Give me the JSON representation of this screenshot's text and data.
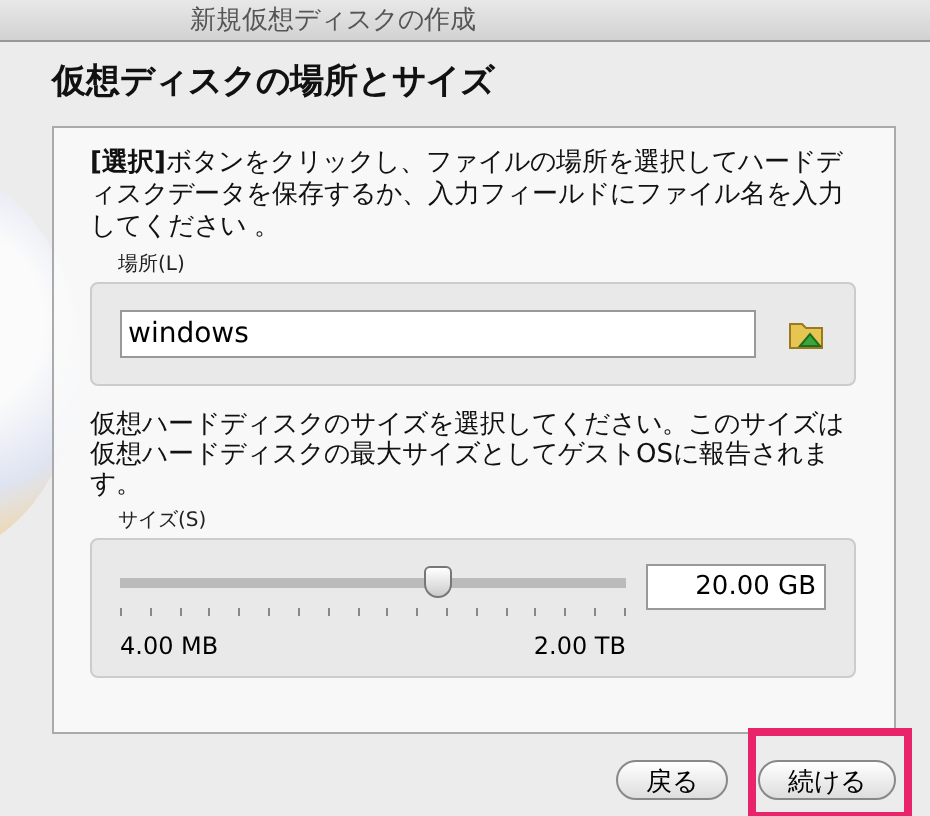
{
  "window": {
    "title": "新規仮想ディスクの作成"
  },
  "heading": "仮想ディスクの場所とサイズ",
  "location_description": "**[選択]**ボタンをクリックし、ファイルの場所を選択してハードディスクデータを保存するか、入力フィールドにファイル名を入力してください 。",
  "location": {
    "label": "場所(L)",
    "value": "windows"
  },
  "size_description": "仮想ハードディスクのサイズを選択してください。このサイズは仮想ハードディスクの最大サイズとしてゲストOSに報告されます。",
  "size": {
    "label": "サイズ(S)",
    "level": 0.63,
    "value": "20.00 GB",
    "min_label": "4.00 MB",
    "max_label": "2.00 TB"
  },
  "buttons": [
    {
      "label": "戻る",
      "highlighted": false
    },
    {
      "label": "続ける",
      "highlighted": true
    }
  ]
}
